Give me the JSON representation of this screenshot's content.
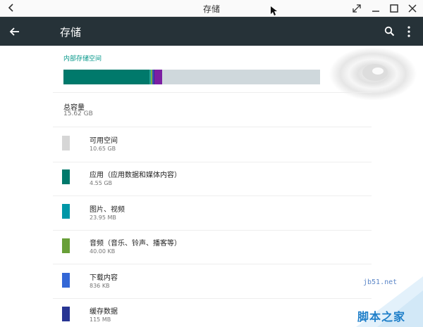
{
  "window": {
    "title": "存储"
  },
  "appbar": {
    "title": "存储",
    "back_icon": "arrow-back-icon",
    "search_icon": "search-icon",
    "more_icon": "more-vert-icon",
    "background": "#263238"
  },
  "storage": {
    "section_label": "内部存储空间",
    "total": {
      "title": "总容量",
      "value": "15.62 GB"
    },
    "bar": {
      "segments": [
        {
          "key": "apps",
          "fraction": 0.334,
          "color": "#00796b"
        },
        {
          "key": "pictures",
          "fraction": 0.006,
          "color": "#26a69a"
        },
        {
          "key": "audio",
          "fraction": 0.006,
          "color": "#7cb342"
        },
        {
          "key": "downloads",
          "fraction": 0.005,
          "color": "#3f51b5"
        },
        {
          "key": "cache",
          "fraction": 0.004,
          "color": "#283593"
        },
        {
          "key": "misc",
          "fraction": 0.03,
          "color": "#7b1fa2"
        }
      ],
      "free_color": "#cfd8dc"
    },
    "items": [
      {
        "label": "可用空间",
        "value": "10.65 GB",
        "color": "#d6d6d6"
      },
      {
        "label": "应用（应用数据和媒体内容）",
        "value": "4.55 GB",
        "color": "#00796b"
      },
      {
        "label": "图片、视频",
        "value": "23.95 MB",
        "color": "#0097a7"
      },
      {
        "label": "音频（音乐、铃声、播客等）",
        "value": "40.00 KB",
        "color": "#689f38"
      },
      {
        "label": "下载内容",
        "value": "836 KB",
        "color": "#3367d6"
      },
      {
        "label": "缓存数据",
        "value": "115 MB",
        "color": "#283593"
      }
    ]
  },
  "watermark": {
    "url": "jb51.net",
    "name": "脚本之家"
  }
}
